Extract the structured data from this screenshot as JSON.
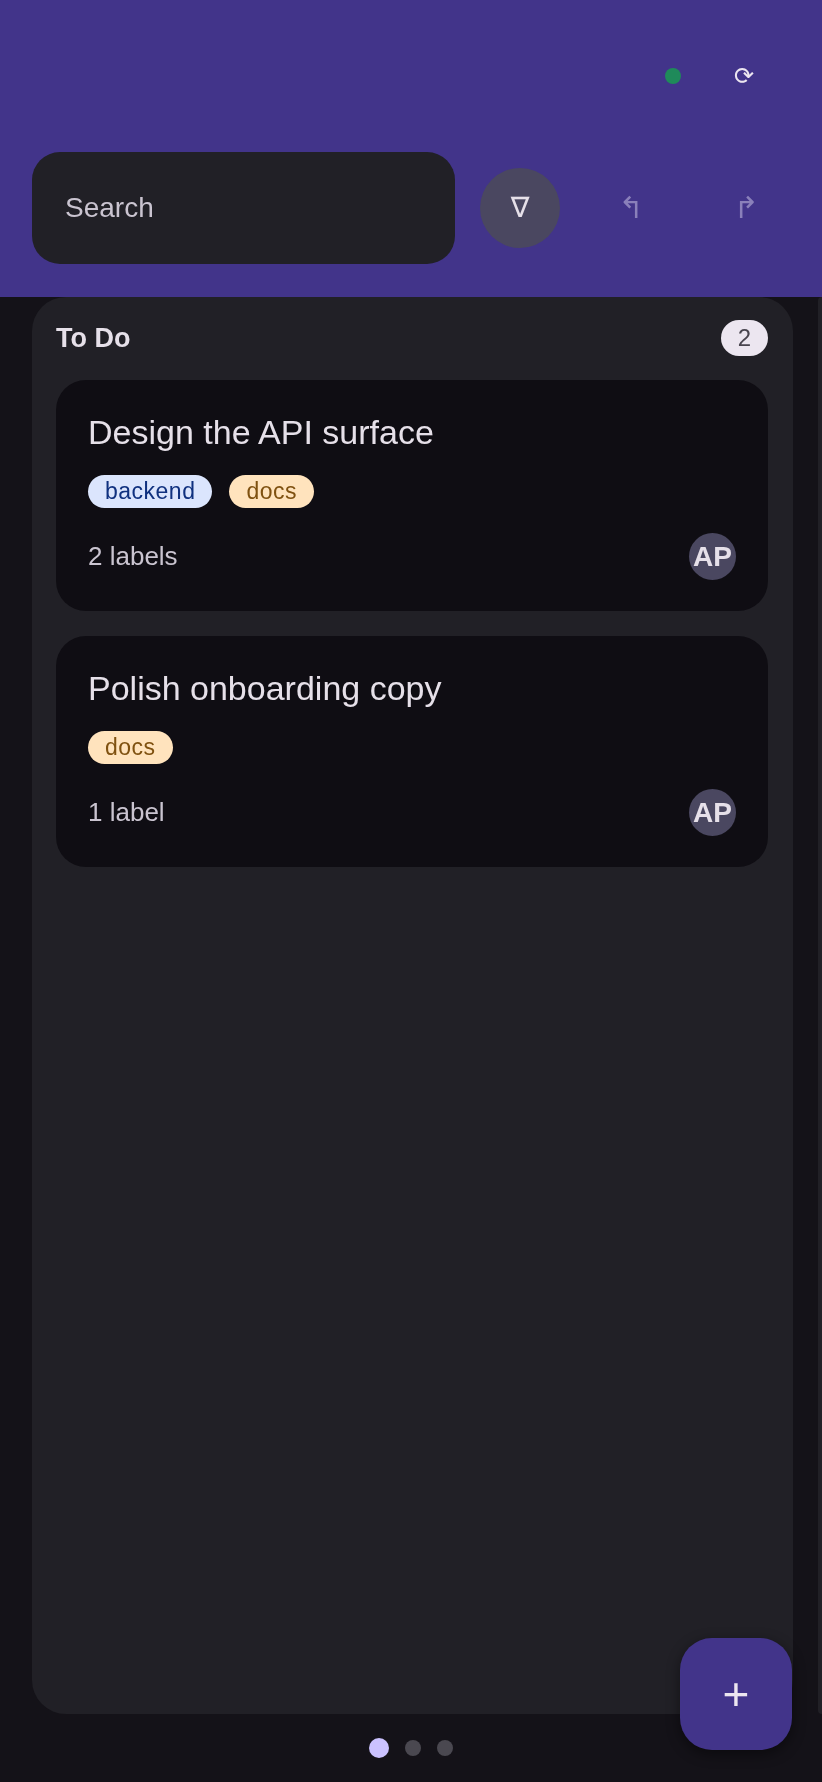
{
  "header": {
    "status_dot": {
      "color": "#1f8a5a"
    },
    "refresh_button": "⟳",
    "search": {
      "placeholder": "Search"
    },
    "filter_button": "∇",
    "undo_button": {
      "glyph": "↰",
      "disabled": true
    },
    "redo_button": {
      "glyph": "↱",
      "disabled": true
    }
  },
  "columns": [
    {
      "title": "To Do",
      "count": "2",
      "cards": [
        {
          "title": "Design the API surface",
          "tags": [
            {
              "label": "backend",
              "color": "#dbe5fd"
            },
            {
              "label": "docs",
              "color": "#ffe3bd"
            }
          ],
          "label_count": "2 labels",
          "assignee": "AP"
        },
        {
          "title": "Polish onboarding copy",
          "tags": [
            {
              "label": "docs",
              "color": "#ffe3bd"
            }
          ],
          "label_count": "1 label",
          "assignee": "AP"
        }
      ]
    }
  ],
  "pager": [
    {
      "selected": true
    },
    {
      "selected": false
    },
    {
      "selected": false
    }
  ],
  "add_button": "+"
}
